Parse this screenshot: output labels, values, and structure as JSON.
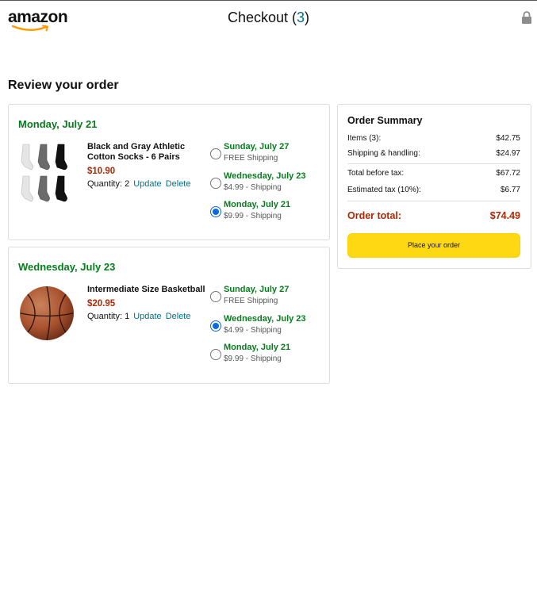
{
  "header": {
    "logo_text": "amazon",
    "title": "Checkout",
    "count": "3",
    "count_open": " (",
    "count_close": ")"
  },
  "review_title": "Review your order",
  "orders": [
    {
      "delivery_date": "Monday, July 21",
      "product": {
        "name": "Black and Gray Athletic Cotton Socks - 6 Pairs",
        "price": "$10.90",
        "quantity_label": "Quantity: 2",
        "update_label": "Update",
        "delete_label": "Delete",
        "image_icon": "socks-image"
      },
      "shipping_options": [
        {
          "day": "Sunday, July 27",
          "cost": "FREE Shipping",
          "selected": false
        },
        {
          "day": "Wednesday, July 23",
          "cost": "$4.99 - Shipping",
          "selected": false
        },
        {
          "day": "Monday, July 21",
          "cost": "$9.99 - Shipping",
          "selected": true
        }
      ]
    },
    {
      "delivery_date": "Wednesday, July 23",
      "product": {
        "name": "Intermediate Size Basketball",
        "price": "$20.95",
        "quantity_label": "Quantity: 1",
        "update_label": "Update",
        "delete_label": "Delete",
        "image_icon": "basketball-image"
      },
      "shipping_options": [
        {
          "day": "Sunday, July 27",
          "cost": "FREE Shipping",
          "selected": false
        },
        {
          "day": "Wednesday, July 23",
          "cost": "$4.99 - Shipping",
          "selected": true
        },
        {
          "day": "Monday, July 21",
          "cost": "$9.99 - Shipping",
          "selected": false
        }
      ]
    }
  ],
  "summary": {
    "title": "Order Summary",
    "items_label": "Items (3):",
    "items_value": "$42.75",
    "shipping_label": "Shipping & handling:",
    "shipping_value": "$24.97",
    "before_tax_label": "Total before tax:",
    "before_tax_value": "$67.72",
    "tax_label": "Estimated tax (10%):",
    "tax_value": "$6.77",
    "total_label": "Order total:",
    "total_value": "$74.49",
    "place_order_label": "Place your order"
  },
  "colors": {
    "delivery_green": "#067d1d",
    "price_red": "#b12704",
    "link_teal": "#007185",
    "button_yellow": "#ffd814",
    "radio_blue": "#0b6bde"
  },
  "icons": {
    "lock": "lock-icon",
    "logo": "amazon-logo"
  }
}
